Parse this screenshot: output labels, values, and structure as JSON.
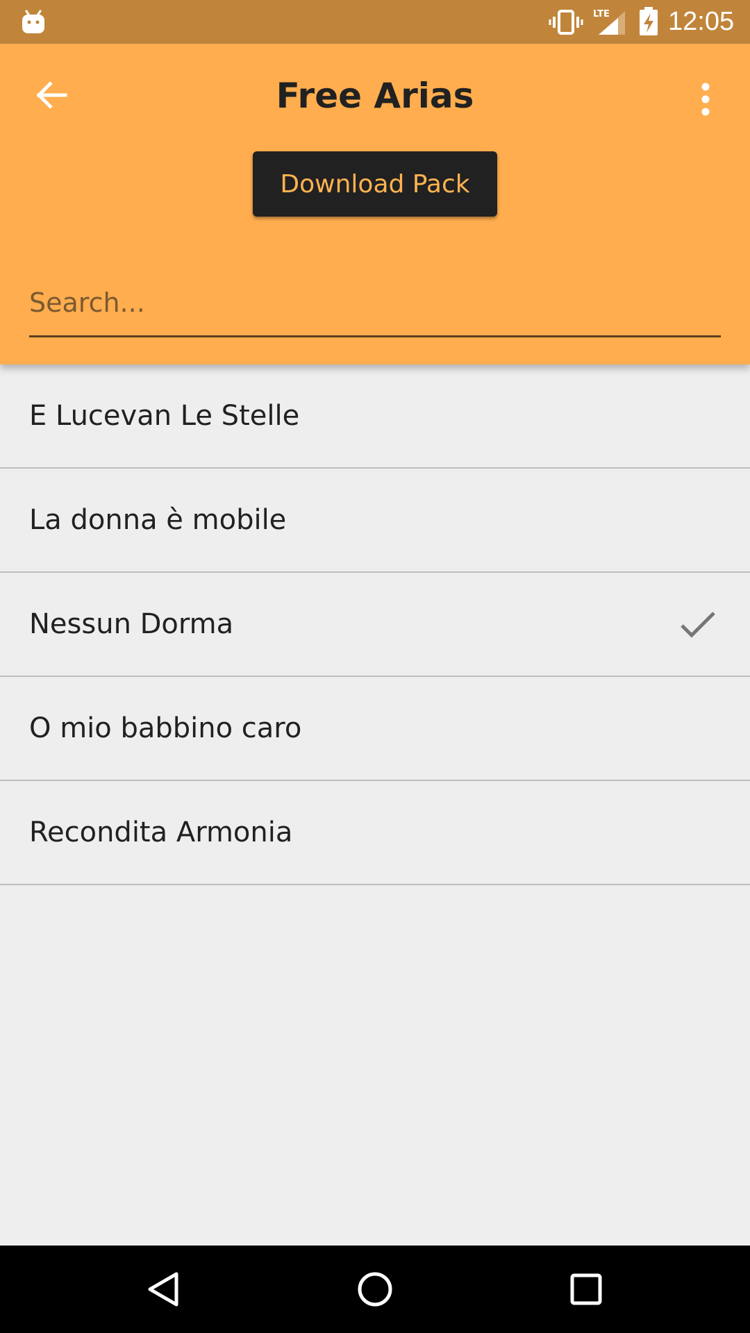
{
  "status_bar": {
    "time": "12:05",
    "icons": [
      "android-icon",
      "vibrate-icon",
      "lte-signal-icon",
      "battery-charging-icon"
    ],
    "background": "#c0853b"
  },
  "app_bar": {
    "title": "Free Arias",
    "back_icon": "arrow-back-icon",
    "more_icon": "more-vert-icon",
    "download_label": "Download Pack",
    "search_placeholder": "Search...",
    "search_value": "",
    "background": "#ffad4e"
  },
  "arias": [
    {
      "title": "E Lucevan Le Stelle",
      "downloaded": false
    },
    {
      "title": "La donna è mobile",
      "downloaded": false
    },
    {
      "title": "Nessun Dorma",
      "downloaded": true
    },
    {
      "title": "O mio babbino caro",
      "downloaded": false
    },
    {
      "title": "Recondita Armonia",
      "downloaded": false
    }
  ],
  "nav_bar": {
    "icons": [
      "nav-back-icon",
      "nav-home-icon",
      "nav-recents-icon"
    ]
  },
  "colors": {
    "accent": "#ffb350",
    "button_dark": "#212121",
    "list_background": "#eeeeee",
    "divider": "#bdbdbd"
  }
}
